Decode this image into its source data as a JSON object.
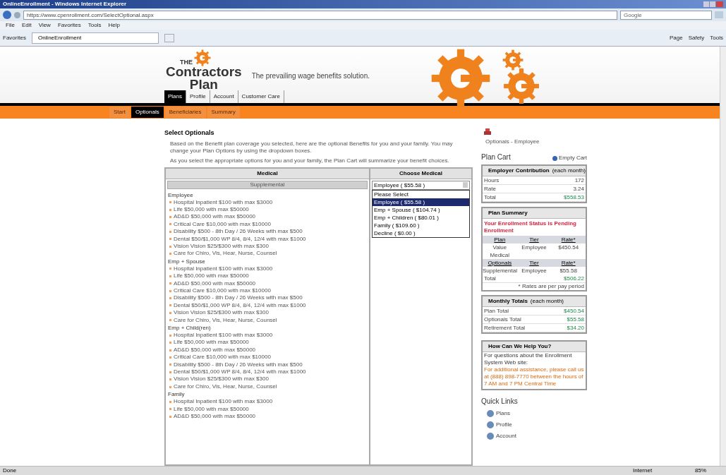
{
  "window": {
    "title": "OnlineEnrollment - Windows Internet Explorer"
  },
  "address_bar": {
    "url": "https://www.cpenrollment.com/SelectOptional.aspx"
  },
  "search": {
    "placeholder": "Google"
  },
  "menu": [
    "File",
    "Edit",
    "View",
    "Favorites",
    "Tools",
    "Help"
  ],
  "favorites_bar": {
    "label": "Favorites",
    "tab": "OnlineEnrollment",
    "tools": [
      "Page",
      "Safety",
      "Tools"
    ]
  },
  "header": {
    "logo_top": "THE",
    "logo_main": "Contractors",
    "logo_bottom": "Plan",
    "tagline": "The prevailing wage benefits solution."
  },
  "main_tabs": [
    {
      "label": "Plans",
      "selected": true
    },
    {
      "label": "Profile",
      "selected": false
    },
    {
      "label": "Account",
      "selected": false
    },
    {
      "label": "Customer Care",
      "selected": false
    }
  ],
  "sub_tabs": [
    {
      "label": "Start",
      "selected": false
    },
    {
      "label": "Optionals",
      "selected": true
    },
    {
      "label": "Beneficiaries",
      "selected": false
    },
    {
      "label": "Summary",
      "selected": false
    }
  ],
  "content": {
    "title": "Select Optionals",
    "paragraphs": [
      "Based on the Benefit plan coverage you selected, here are the optional Benefits for you and your family. You may change your Plan Options by using the dropdown boxes.",
      "As you select the appropriate options for you and your family, the Plan Cart will summarize your benefit choices."
    ],
    "table": {
      "column_1": "Medical",
      "column_2": "Choose Medical",
      "subheader": "Supplemental",
      "groups": [
        {
          "name": "Employee",
          "items": [
            "Hospital Inpatient $100 with max $3000",
            "Life $50,000 with max $50000",
            "AD&D $50,000 with max $50000",
            "Critical Care $10,000 with max $10000",
            "Disability $500 - 8th Day / 26 Weeks with max $500",
            "Dental $50/$1,000 WP 8/4, 8/4, 12/4 with max $1000",
            "Vision Vision $25/$300 with max $300",
            "Care for Chiro, Vis, Hear, Nurse, Counsel"
          ]
        },
        {
          "name": "Emp + Spouse",
          "items": [
            "Hospital Inpatient $100 with max $3000",
            "Life $50,000 with max $50000",
            "AD&D $50,000 with max $50000",
            "Critical Care $10,000 with max $10000",
            "Disability $500 - 8th Day / 26 Weeks with max $500",
            "Dental $50/$1,000 WP 8/4, 8/4, 12/4 with max $1000",
            "Vision Vision $25/$300 with max $300",
            "Care for Chiro, Vis, Hear, Nurse, Counsel"
          ]
        },
        {
          "name": "Emp + Child(ren)",
          "items": [
            "Hospital Inpatient $100 with max $3000",
            "Life $50,000 with max $50000",
            "AD&D $50,000 with max $50000",
            "Critical Care $10,000 with max $10000",
            "Disability $500 - 8th Day / 26 Weeks with max $500",
            "Dental $50/$1,000 WP 8/4, 8/4, 12/4 with max $1000",
            "Vision Vision $25/$300 with max $300",
            "Care for Chiro, Vis, Hear, Nurse, Counsel"
          ]
        },
        {
          "name": "Family",
          "items": [
            "Hospital Inpatient $100 with max $3000",
            "Life $50,000 with max $50000",
            "AD&D $50,000 with max $50000"
          ]
        }
      ],
      "select": {
        "value": "Employee ( $55.58 )",
        "options": [
          {
            "label": "Please Select",
            "selected": false
          },
          {
            "label": "Employee ( $55.58 )",
            "selected": true
          },
          {
            "label": "Emp + Spouse ( $104.74 )",
            "selected": false
          },
          {
            "label": "Emp + Children ( $80.01 )",
            "selected": false
          },
          {
            "label": "Family ( $109.60 )",
            "selected": false
          },
          {
            "label": "Decline ( $0.00 )",
            "selected": false
          }
        ]
      }
    }
  },
  "sidebar": {
    "breadcrumb": "Optionals - Employee",
    "cart_title": "Plan Cart",
    "empty_cart": "Empty Cart",
    "contribution": {
      "title": "Employer Contribution",
      "note": "(each month)",
      "rows": [
        {
          "label": "Hours",
          "value": "172"
        },
        {
          "label": "Rate",
          "value": "3.24"
        },
        {
          "label": "Total",
          "value": "$558.53"
        }
      ]
    },
    "summary": {
      "title": "Plan Summary",
      "status": "Your Enrollment Status is Pending Enrollment",
      "plan_head": [
        "Plan",
        "Tier",
        "Rate*"
      ],
      "plan_row": [
        "Value Medical",
        "Employee",
        "$450.54"
      ],
      "opt_head": [
        "Optionals",
        "Tier",
        "Rate*"
      ],
      "opt_row": [
        "Supplemental",
        "Employee",
        "$55.58"
      ],
      "total_label": "Total",
      "total": "$506.22",
      "footnote": "* Rates are per pay period"
    },
    "monthly": {
      "title": "Monthly Totals",
      "note": "(each month)",
      "rows": [
        {
          "label": "Plan Total",
          "value": "$450.54"
        },
        {
          "label": "Optionals Total",
          "value": "$55.58"
        },
        {
          "label": "Retirement Total",
          "value": "$34.20"
        }
      ]
    },
    "help": {
      "title": "How Can We Help You?",
      "text": "For questions about the Enrollment System Web site:",
      "contact": "For additional assistance, please call us at (888) 898-7770 between the hours of 7 AM and 7 PM Central Time"
    },
    "quick_links_title": "Quick Links",
    "quick_links": [
      "Plans",
      "Profile",
      "Account"
    ]
  },
  "status_bar": {
    "left": "Done",
    "zone": "Internet",
    "zoom": "85%"
  }
}
